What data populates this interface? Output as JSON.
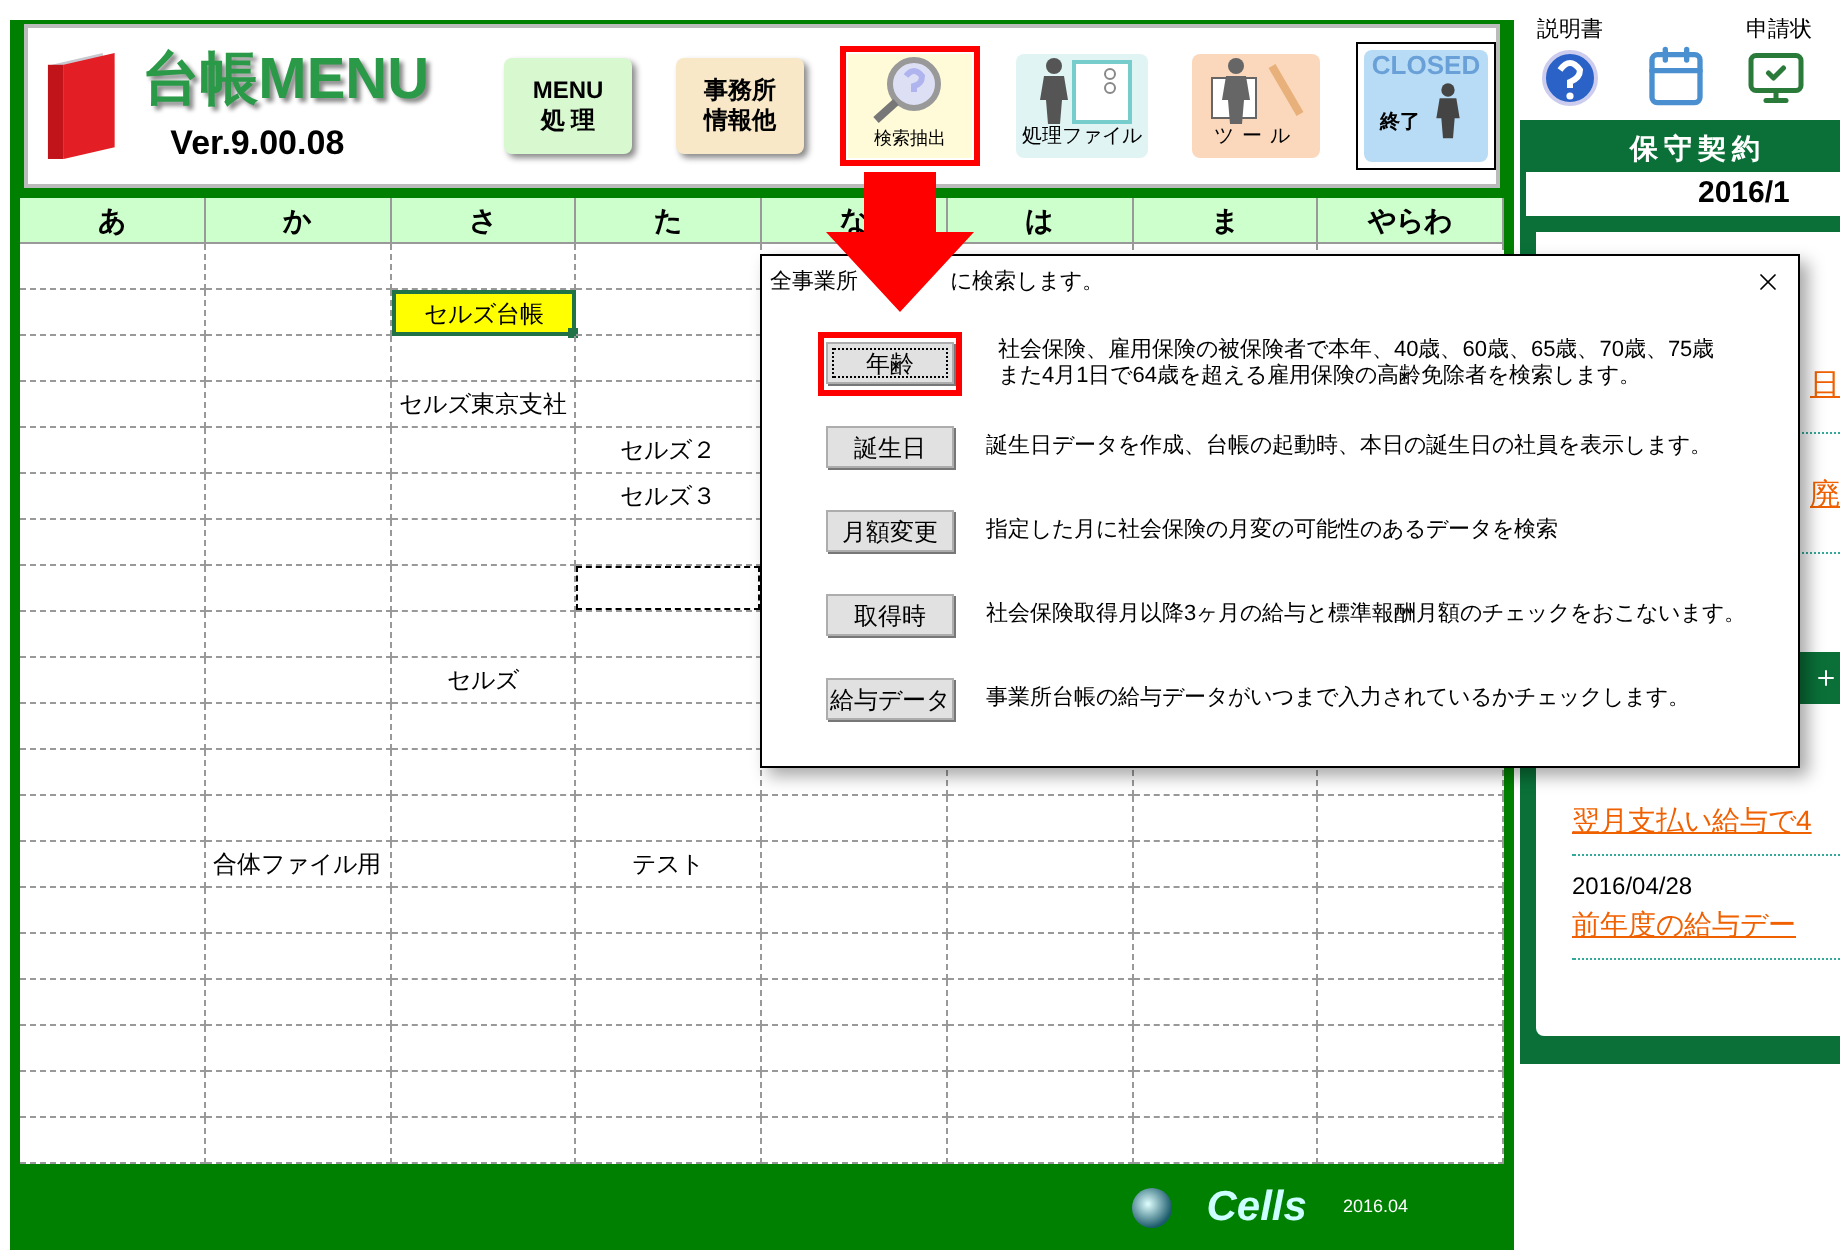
{
  "header": {
    "title": "台帳MENU",
    "version": "Ver.9.00.08",
    "buttons": [
      {
        "kind": "menu",
        "lines": [
          "MENU",
          "処 理"
        ],
        "selected": false
      },
      {
        "kind": "office",
        "lines": [
          "事務所",
          "情報他"
        ],
        "selected": false
      },
      {
        "kind": "search",
        "label": "検索抽出",
        "selected": true
      },
      {
        "kind": "files",
        "label": "処理ファイル",
        "selected": false
      },
      {
        "kind": "tools",
        "label": "ツール",
        "selected": false
      },
      {
        "kind": "closed",
        "caption": "CLOSED",
        "label": "終了",
        "selected": false
      }
    ]
  },
  "grid": {
    "columns": [
      "あ",
      "か",
      "さ",
      "た",
      "な",
      "は",
      "ま",
      "やらわ"
    ],
    "rows": [
      [
        {
          "selected": false,
          "copied": false
        },
        {
          "selected": false,
          "copied": false
        },
        {
          "selected": false,
          "copied": false
        },
        {
          "selected": false,
          "copied": false
        }
      ],
      [
        {
          "selected": false,
          "copied": false
        },
        {
          "selected": false,
          "copied": false
        },
        {
          "text": "セルズ台帳",
          "selected": true,
          "copied": false
        },
        {
          "selected": false,
          "copied": false
        }
      ],
      [
        {
          "selected": false,
          "copied": false
        },
        {
          "selected": false,
          "copied": false
        },
        {
          "selected": false,
          "copied": false
        },
        {
          "selected": false,
          "copied": false
        }
      ],
      [
        {
          "selected": false,
          "copied": false
        },
        {
          "selected": false,
          "copied": false
        },
        {
          "text": "セルズ東京支社",
          "selected": false,
          "copied": false
        },
        {
          "selected": false,
          "copied": false
        }
      ],
      [
        {
          "selected": false,
          "copied": false
        },
        {
          "selected": false,
          "copied": false
        },
        {
          "selected": false,
          "copied": false
        },
        {
          "text": "セルズ２",
          "selected": false,
          "copied": false
        }
      ],
      [
        {
          "selected": false,
          "copied": false
        },
        {
          "selected": false,
          "copied": false
        },
        {
          "selected": false,
          "copied": false
        },
        {
          "text": "セルズ３",
          "selected": false,
          "copied": false
        }
      ],
      [
        {
          "selected": false,
          "copied": false
        },
        {
          "selected": false,
          "copied": false
        },
        {
          "selected": false,
          "copied": false
        },
        {
          "selected": false,
          "copied": false
        }
      ],
      [
        {
          "selected": false,
          "copied": false
        },
        {
          "selected": false,
          "copied": false
        },
        {
          "selected": false,
          "copied": false
        },
        {
          "selected": false,
          "copied": true
        }
      ],
      [
        {
          "selected": false,
          "copied": false
        },
        {
          "selected": false,
          "copied": false
        },
        {
          "selected": false,
          "copied": false
        },
        {
          "selected": false,
          "copied": false
        }
      ],
      [
        {
          "selected": false,
          "copied": false
        },
        {
          "selected": false,
          "copied": false
        },
        {
          "text": "セルズ",
          "selected": false,
          "copied": false
        },
        {
          "selected": false,
          "copied": false
        }
      ],
      [
        {
          "selected": false,
          "copied": false
        },
        {
          "selected": false,
          "copied": false
        },
        {
          "selected": false,
          "copied": false
        },
        {
          "selected": false,
          "copied": false
        }
      ],
      [
        {
          "selected": false,
          "copied": false
        },
        {
          "selected": false,
          "copied": false
        },
        {
          "selected": false,
          "copied": false
        },
        {
          "selected": false,
          "copied": false
        }
      ],
      [
        {
          "selected": false,
          "copied": false
        },
        {
          "selected": false,
          "copied": false
        },
        {
          "selected": false,
          "copied": false
        },
        {
          "selected": false,
          "copied": false
        },
        {
          "selected": false,
          "copied": false
        },
        {
          "selected": false,
          "copied": false
        },
        {
          "selected": false,
          "copied": false
        },
        {
          "selected": false,
          "copied": false
        }
      ],
      [
        {
          "selected": false,
          "copied": false
        },
        {
          "text": "合体ファイル用",
          "selected": false,
          "copied": false
        },
        {
          "selected": false,
          "copied": false
        },
        {
          "text": "テスト",
          "selected": false,
          "copied": false
        },
        {
          "selected": false,
          "copied": false
        },
        {
          "selected": false,
          "copied": false
        },
        {
          "selected": false,
          "copied": false
        },
        {
          "selected": false,
          "copied": false
        }
      ],
      [
        {
          "selected": false,
          "copied": false
        },
        {
          "selected": false,
          "copied": false
        },
        {
          "selected": false,
          "copied": false
        },
        {
          "selected": false,
          "copied": false
        },
        {
          "selected": false,
          "copied": false
        },
        {
          "selected": false,
          "copied": false
        },
        {
          "selected": false,
          "copied": false
        },
        {
          "selected": false,
          "copied": false
        }
      ],
      [
        {
          "selected": false,
          "copied": false
        },
        {
          "selected": false,
          "copied": false
        },
        {
          "selected": false,
          "copied": false
        },
        {
          "selected": false,
          "copied": false
        },
        {
          "selected": false,
          "copied": false
        },
        {
          "selected": false,
          "copied": false
        },
        {
          "selected": false,
          "copied": false
        },
        {
          "selected": false,
          "copied": false
        }
      ],
      [
        {
          "selected": false,
          "copied": false
        },
        {
          "selected": false,
          "copied": false
        },
        {
          "selected": false,
          "copied": false
        },
        {
          "selected": false,
          "copied": false
        },
        {
          "selected": false,
          "copied": false
        },
        {
          "selected": false,
          "copied": false
        },
        {
          "selected": false,
          "copied": false
        },
        {
          "selected": false,
          "copied": false
        }
      ],
      [
        {
          "selected": false,
          "copied": false
        },
        {
          "selected": false,
          "copied": false
        },
        {
          "selected": false,
          "copied": false
        },
        {
          "selected": false,
          "copied": false
        },
        {
          "selected": false,
          "copied": false
        },
        {
          "selected": false,
          "copied": false
        },
        {
          "selected": false,
          "copied": false
        },
        {
          "selected": false,
          "copied": false
        }
      ],
      [
        {
          "selected": false,
          "copied": false
        },
        {
          "selected": false,
          "copied": false
        },
        {
          "selected": false,
          "copied": false
        },
        {
          "selected": false,
          "copied": false
        },
        {
          "selected": false,
          "copied": false
        },
        {
          "selected": false,
          "copied": false
        },
        {
          "selected": false,
          "copied": false
        },
        {
          "selected": false,
          "copied": false
        }
      ],
      [
        {
          "selected": false,
          "copied": false
        },
        {
          "selected": false,
          "copied": false
        },
        {
          "selected": false,
          "copied": false
        },
        {
          "selected": false,
          "copied": false
        },
        {
          "selected": false,
          "copied": false
        },
        {
          "selected": false,
          "copied": false
        },
        {
          "selected": false,
          "copied": false
        },
        {
          "selected": false,
          "copied": false
        }
      ]
    ]
  },
  "footer": {
    "brand": "Cells",
    "date": "2016.04"
  },
  "dialog": {
    "title_parts": [
      "全事業所",
      "に検索します。"
    ],
    "items": [
      {
        "button": "年齢",
        "description": [
          "社会保険、雇用保険の被保険者で本年、40歳、60歳、65歳、70歳、75歳",
          "また4月1日で64歳を超える雇用保険の高齢免除者を検索します。"
        ],
        "selected": true
      },
      {
        "button": "誕生日",
        "description": [
          "誕生日データを作成、台帳の起動時、本日の誕生日の社員を表示します。"
        ],
        "selected": false
      },
      {
        "button": "月額変更",
        "description": [
          "指定した月に社会保険の月変の可能性のあるデータを検索"
        ],
        "selected": false
      },
      {
        "button": "取得時",
        "description": [
          "社会保険取得月以降3ヶ月の給与と標準報酬月額のチェックをおこないます。"
        ],
        "selected": false
      },
      {
        "button": "給与データ",
        "description": [
          "事業所台帳の給与データがいつまで入力されているかチェックします。"
        ],
        "selected": false
      }
    ]
  },
  "side": {
    "help_label": "説明書",
    "status_label": "申請状",
    "panel_title": "保守契約",
    "date": "2016/1",
    "link_fragments": [
      "日",
      "廃"
    ],
    "news": [
      {
        "title": "翌月支払い給与で4"
      },
      {
        "date": "2016/04/28",
        "title": "前年度の給与デー"
      }
    ]
  }
}
